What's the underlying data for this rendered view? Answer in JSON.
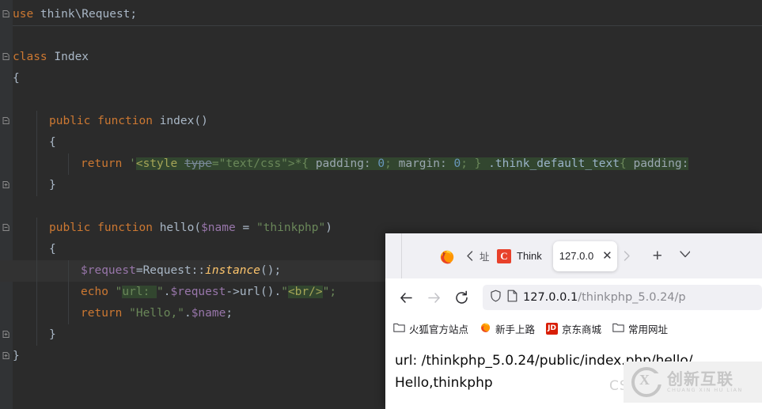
{
  "editor": {
    "language": "php",
    "lines": [
      {
        "indent": 0,
        "fold": "collapse",
        "tokens": [
          {
            "t": "use ",
            "c": "kw"
          },
          {
            "t": "think\\Request;",
            "c": "plain"
          }
        ]
      },
      {
        "indent": 0,
        "fold": "none",
        "separator_below": true,
        "tokens": []
      },
      {
        "indent": 0,
        "fold": "collapse",
        "tokens": [
          {
            "t": "class ",
            "c": "kw"
          },
          {
            "t": "Index",
            "c": "cls"
          }
        ]
      },
      {
        "indent": 0,
        "fold": "none",
        "tokens": [
          {
            "t": "{",
            "c": "plain"
          }
        ]
      },
      {
        "indent": 0,
        "fold": "none",
        "tokens": []
      },
      {
        "indent": 1,
        "fold": "collapse",
        "tokens": [
          {
            "t": "public function ",
            "c": "kw"
          },
          {
            "t": "index",
            "c": "fname"
          },
          {
            "t": "()",
            "c": "plain"
          }
        ]
      },
      {
        "indent": 1,
        "fold": "none",
        "tokens": [
          {
            "t": "{",
            "c": "plain"
          }
        ]
      },
      {
        "indent": 2,
        "fold": "none",
        "tokens": [
          {
            "t": "return ",
            "c": "kw"
          },
          {
            "t": "'",
            "c": "str"
          },
          {
            "t": "<style ",
            "c": "hl-tag"
          },
          {
            "t": "type",
            "c": "strike-hl"
          },
          {
            "t": "=\"text/css\">*{ ",
            "c": "hl-str"
          },
          {
            "t": "padding: ",
            "c": "hl-prop"
          },
          {
            "t": "0",
            "c": "hl-num"
          },
          {
            "t": "; ",
            "c": "hl-str"
          },
          {
            "t": "margin: ",
            "c": "hl-prop"
          },
          {
            "t": "0",
            "c": "hl-num"
          },
          {
            "t": "; ",
            "c": "hl-str"
          },
          {
            "t": "} ",
            "c": "hl-str"
          },
          {
            "t": ".think_default_text",
            "c": "hl-sel"
          },
          {
            "t": "{ ",
            "c": "hl-str"
          },
          {
            "t": "padding:",
            "c": "hl-prop"
          }
        ]
      },
      {
        "indent": 1,
        "fold": "expand",
        "tokens": [
          {
            "t": "}",
            "c": "plain"
          }
        ]
      },
      {
        "indent": 0,
        "fold": "none",
        "tokens": []
      },
      {
        "indent": 1,
        "fold": "collapse",
        "tokens": [
          {
            "t": "public function ",
            "c": "kw"
          },
          {
            "t": "hello",
            "c": "fname"
          },
          {
            "t": "(",
            "c": "plain"
          },
          {
            "t": "$name",
            "c": "var"
          },
          {
            "t": " = ",
            "c": "plain"
          },
          {
            "t": "\"thinkphp\"",
            "c": "str"
          },
          {
            "t": ")",
            "c": "plain"
          }
        ]
      },
      {
        "indent": 1,
        "fold": "none",
        "tokens": [
          {
            "t": "{",
            "c": "plain"
          }
        ]
      },
      {
        "indent": 2,
        "fold": "none",
        "current": true,
        "tokens": [
          {
            "t": "$request",
            "c": "var"
          },
          {
            "t": "=Request::",
            "c": "plain"
          },
          {
            "t": "instance",
            "c": "italic"
          },
          {
            "t": "();",
            "c": "plain"
          }
        ]
      },
      {
        "indent": 2,
        "fold": "none",
        "tokens": [
          {
            "t": "echo ",
            "c": "kw"
          },
          {
            "t": "\"",
            "c": "str"
          },
          {
            "t": "url: ",
            "c": "hl-str"
          },
          {
            "t": "\"",
            "c": "str"
          },
          {
            "t": ".",
            "c": "plain"
          },
          {
            "t": "$request",
            "c": "var"
          },
          {
            "t": "->url().",
            "c": "plain"
          },
          {
            "t": "\"",
            "c": "str"
          },
          {
            "t": "<br/>",
            "c": "hl-tag"
          },
          {
            "t": "\";",
            "c": "str"
          }
        ]
      },
      {
        "indent": 2,
        "fold": "none",
        "tokens": [
          {
            "t": "return ",
            "c": "kw"
          },
          {
            "t": "\"Hello,\"",
            "c": "str"
          },
          {
            "t": ".",
            "c": "plain"
          },
          {
            "t": "$name",
            "c": "var"
          },
          {
            "t": ";",
            "c": "plain"
          }
        ]
      },
      {
        "indent": 1,
        "fold": "expand",
        "tokens": [
          {
            "t": "}",
            "c": "plain"
          }
        ]
      },
      {
        "indent": 0,
        "fold": "expand",
        "tokens": [
          {
            "t": "}",
            "c": "plain"
          }
        ]
      }
    ]
  },
  "browser": {
    "tabs": {
      "clipped_left_label": "址",
      "scroll_left_icon": "chevron-left-icon",
      "scroll_right_icon": "chevron-right-icon",
      "firefox_icon": "firefox-logo-icon",
      "items": [
        {
          "favicon": "csdn-c-icon",
          "favicon_letter": "C",
          "title": "Think",
          "active": false
        },
        {
          "favicon": "none",
          "title": "127.0.0",
          "active": true,
          "close_label": "✕"
        }
      ],
      "new_tab_label": "+",
      "tab_list_icon": "chevron-down-icon"
    },
    "toolbar": {
      "back_icon": "arrow-left-icon",
      "forward_icon": "arrow-right-icon",
      "reload_icon": "reload-icon",
      "shield_icon": "shield-icon",
      "page_icon": "page-info-icon",
      "url_host": "127.0.0.1",
      "url_path": "/thinkphp_5.0.24/p"
    },
    "bookmarks": [
      {
        "icon": "folder-icon",
        "label": "火狐官方站点"
      },
      {
        "icon": "firefox-logo-icon",
        "label": "新手上路"
      },
      {
        "icon": "jd-icon",
        "icon_letter": "JD",
        "label": "京东商城"
      },
      {
        "icon": "folder-icon",
        "label": "常用网址"
      }
    ],
    "page": {
      "line1": "url:  /thinkphp_5.0.24/public/index.php/hello/",
      "line2": "Hello,thinkphp",
      "watermark_text": "CSDN",
      "logo_cn": "创新互联",
      "logo_en": "CHUANG XIN HU LIAN",
      "logo_mark": "X"
    }
  },
  "colors": {
    "editor_bg": "#2b2b2b",
    "gutter_bg": "#313335",
    "keyword": "#cc7832",
    "string": "#6a8759",
    "variable": "#9876aa",
    "number": "#6897bb",
    "plain": "#a9b7c6",
    "highlight_bg": "#32462f",
    "current_line": "#323232",
    "browser_chrome": "#f0f0f4",
    "csdn_red": "#e8412b",
    "jd_red": "#d81e06"
  }
}
